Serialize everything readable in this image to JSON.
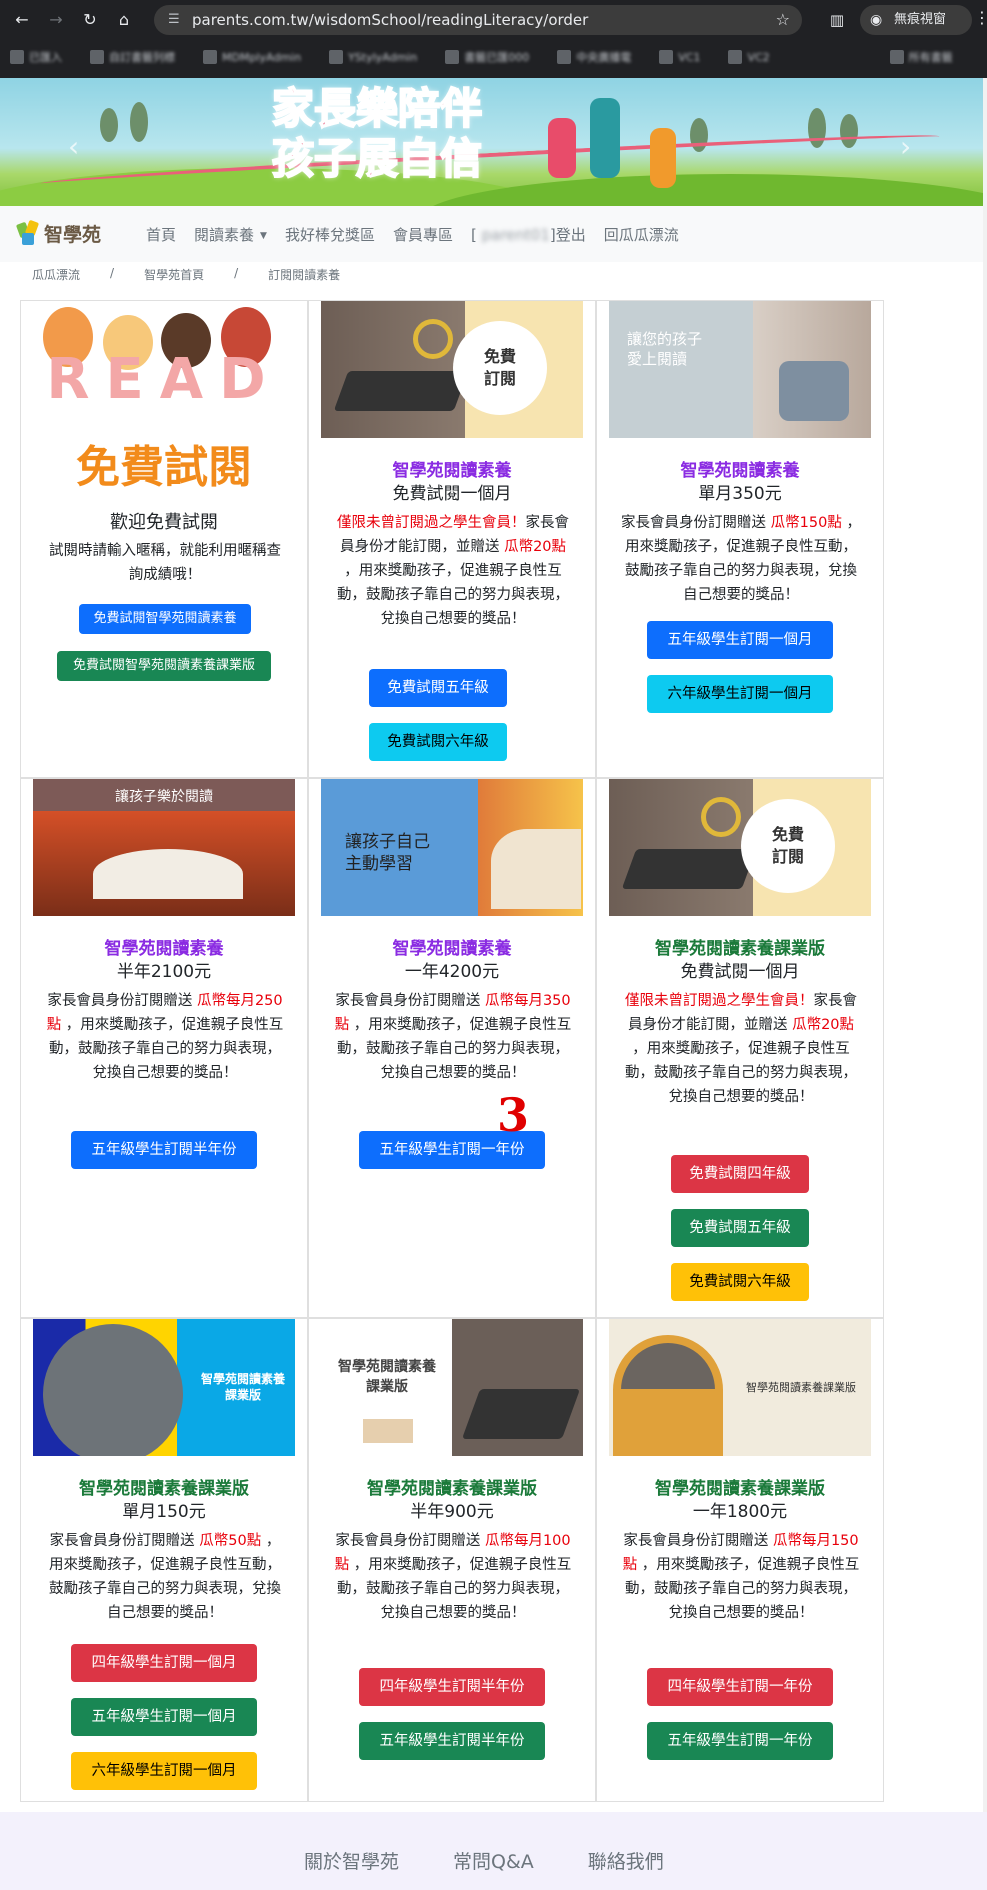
{
  "browser": {
    "url": "parents.com.tw/wisdomSchool/readingLiteracy/order",
    "incognito_label": "無痕視窗",
    "bookmarks": [
      "已匯入",
      "自訂書籤列標",
      "MDMplyAdmin",
      "YStylyAdmin",
      "書籤已匯000",
      "中央廣播電",
      "VC1",
      "VC2",
      "所有書籤"
    ]
  },
  "banner": {
    "line1": "家長樂陪伴",
    "line2": "孩子展自信"
  },
  "nav": {
    "logo_text": "智學苑",
    "links": [
      "首頁",
      "閱讀素養",
      "我好棒兌獎區",
      "會員專區"
    ],
    "user_prefix": "[",
    "user_name": "parent01",
    "user_suffix": "]登出",
    "back_link": "回瓜瓜漂流"
  },
  "breadcrumb": [
    "瓜瓜漂流",
    "智學苑首頁",
    "訂閱閱讀素養"
  ],
  "cards": {
    "c1": {
      "img_text_read": "READ",
      "img_text_trial": "免費試閱",
      "sub": "歡迎免費試閱",
      "desc": "試閱時請輸入暱稱，就能利用暱稱查詢成績哦！",
      "btn1": "免費試閱智學苑閱讀素養",
      "btn2": "免費試閱智學苑閱讀素養課業版"
    },
    "c2": {
      "img_badge": "免費\n訂閱",
      "title": "智學苑閱讀素養",
      "sub": "免費試閱一個月",
      "desc_red1": "僅限未曾訂閱過之學生會員！",
      "desc_black1": "家長會員身份才能訂閱，並贈送",
      "desc_red2": "瓜幣20點",
      "desc_black2": "，用來獎勵孩子，促進親子良性互動，鼓勵孩子靠自己的努力與表現，兌換自己想要的獎品！",
      "btn1": "免費試閱五年級",
      "btn2": "免費試閱六年級"
    },
    "c3": {
      "img_text": "讓您的孩子\n愛上閱讀",
      "title": "智學苑閱讀素養",
      "sub": "單月350元",
      "desc_black1": "家長會員身份訂閱贈送",
      "desc_red": "瓜幣150點",
      "desc_black2": "，用來獎勵孩子，促進親子良性互動，鼓勵孩子靠自己的努力與表現，兌換自己想要的獎品！",
      "btn1": "五年級學生訂閱一個月",
      "btn2": "六年級學生訂閱一個月"
    },
    "c4": {
      "img_text": "讓孩子樂於閱讀",
      "title": "智學苑閱讀素養",
      "sub": "半年2100元",
      "desc_black1": "家長會員身份訂閱贈送",
      "desc_red": "瓜幣每月250點",
      "desc_black2": "，用來獎勵孩子，促進親子良性互動，鼓勵孩子靠自己的努力與表現，兌換自己想要的獎品！",
      "btn1": "五年級學生訂閱半年份"
    },
    "c5": {
      "img_text": "讓孩子自己\n主動學習",
      "title": "智學苑閱讀素養",
      "sub": "一年4200元",
      "desc_black1": "家長會員身份訂閱贈送",
      "desc_red": "瓜幣每月350點",
      "desc_black2": "，用來獎勵孩子，促進親子良性互動，鼓勵孩子靠自己的努力與表現，兌換自己想要的獎品！",
      "btn1": "五年級學生訂閱一年份"
    },
    "c6": {
      "img_badge": "免費\n訂閱",
      "title": "智學苑閱讀素養課業版",
      "sub": "免費試閱一個月",
      "desc_red1": "僅限未曾訂閱過之學生會員！",
      "desc_black1": "家長會員身份才能訂閱，並贈送",
      "desc_red2": "瓜幣20點",
      "desc_black2": "，用來獎勵孩子，促進親子良性互動，鼓勵孩子靠自己的努力與表現，兌換自己想要的獎品！",
      "btn1": "免費試閱四年級",
      "btn2": "免費試閱五年級",
      "btn3": "免費試閱六年級"
    },
    "c7": {
      "img_text": "智學苑閱讀素養\n課業版",
      "title": "智學苑閱讀素養課業版",
      "sub": "單月150元",
      "desc_black1": "家長會員身份訂閱贈送",
      "desc_red": "瓜幣50點",
      "desc_black2": "，用來獎勵孩子，促進親子良性互動，鼓勵孩子靠自己的努力與表現，兌換自己想要的獎品！",
      "btn1": "四年級學生訂閱一個月",
      "btn2": "五年級學生訂閱一個月",
      "btn3": "六年級學生訂閱一個月"
    },
    "c8": {
      "img_text": "智學苑閱讀素養\n課業版",
      "title": "智學苑閱讀素養課業版",
      "sub": "半年900元",
      "desc_black1": "家長會員身份訂閱贈送",
      "desc_red": "瓜幣每月100點",
      "desc_black2": "，用來獎勵孩子，促進親子良性互動，鼓勵孩子靠自己的努力與表現，兌換自己想要的獎品！",
      "btn1": "四年級學生訂閱半年份",
      "btn2": "五年級學生訂閱半年份"
    },
    "c9": {
      "img_text": "智學苑閱讀素養課業版",
      "title": "智學苑閱讀素養課業版",
      "sub": "一年1800元",
      "desc_black1": "家長會員身份訂閱贈送",
      "desc_red": "瓜幣每月150點",
      "desc_black2": "，用來獎勵孩子，促進親子良性互動，鼓勵孩子靠自己的努力與表現，兌換自己想要的獎品！",
      "btn1": "四年級學生訂閱一年份",
      "btn2": "五年級學生訂閱一年份"
    }
  },
  "annotation_mark": "3",
  "footer": {
    "links": [
      "關於智學苑",
      "常問Q&A",
      "聯絡我們"
    ]
  }
}
